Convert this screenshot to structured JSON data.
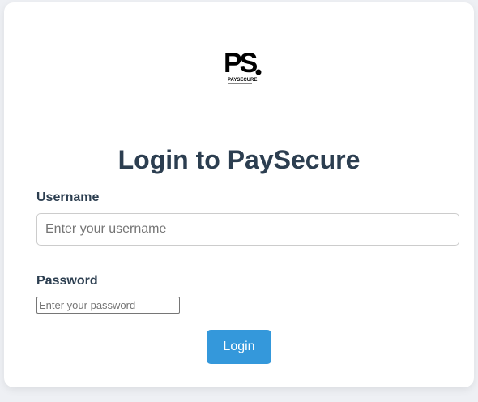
{
  "logo": {
    "text": "PS.",
    "wordmark": "PAYSECURE"
  },
  "title": "Login to PaySecure",
  "username": {
    "label": "Username",
    "placeholder": "Enter your username",
    "value": ""
  },
  "password": {
    "label": "Password",
    "placeholder": "Enter your password",
    "value": ""
  },
  "login_button": "Login",
  "colors": {
    "accent": "#3498db",
    "heading": "#2c3e50"
  }
}
